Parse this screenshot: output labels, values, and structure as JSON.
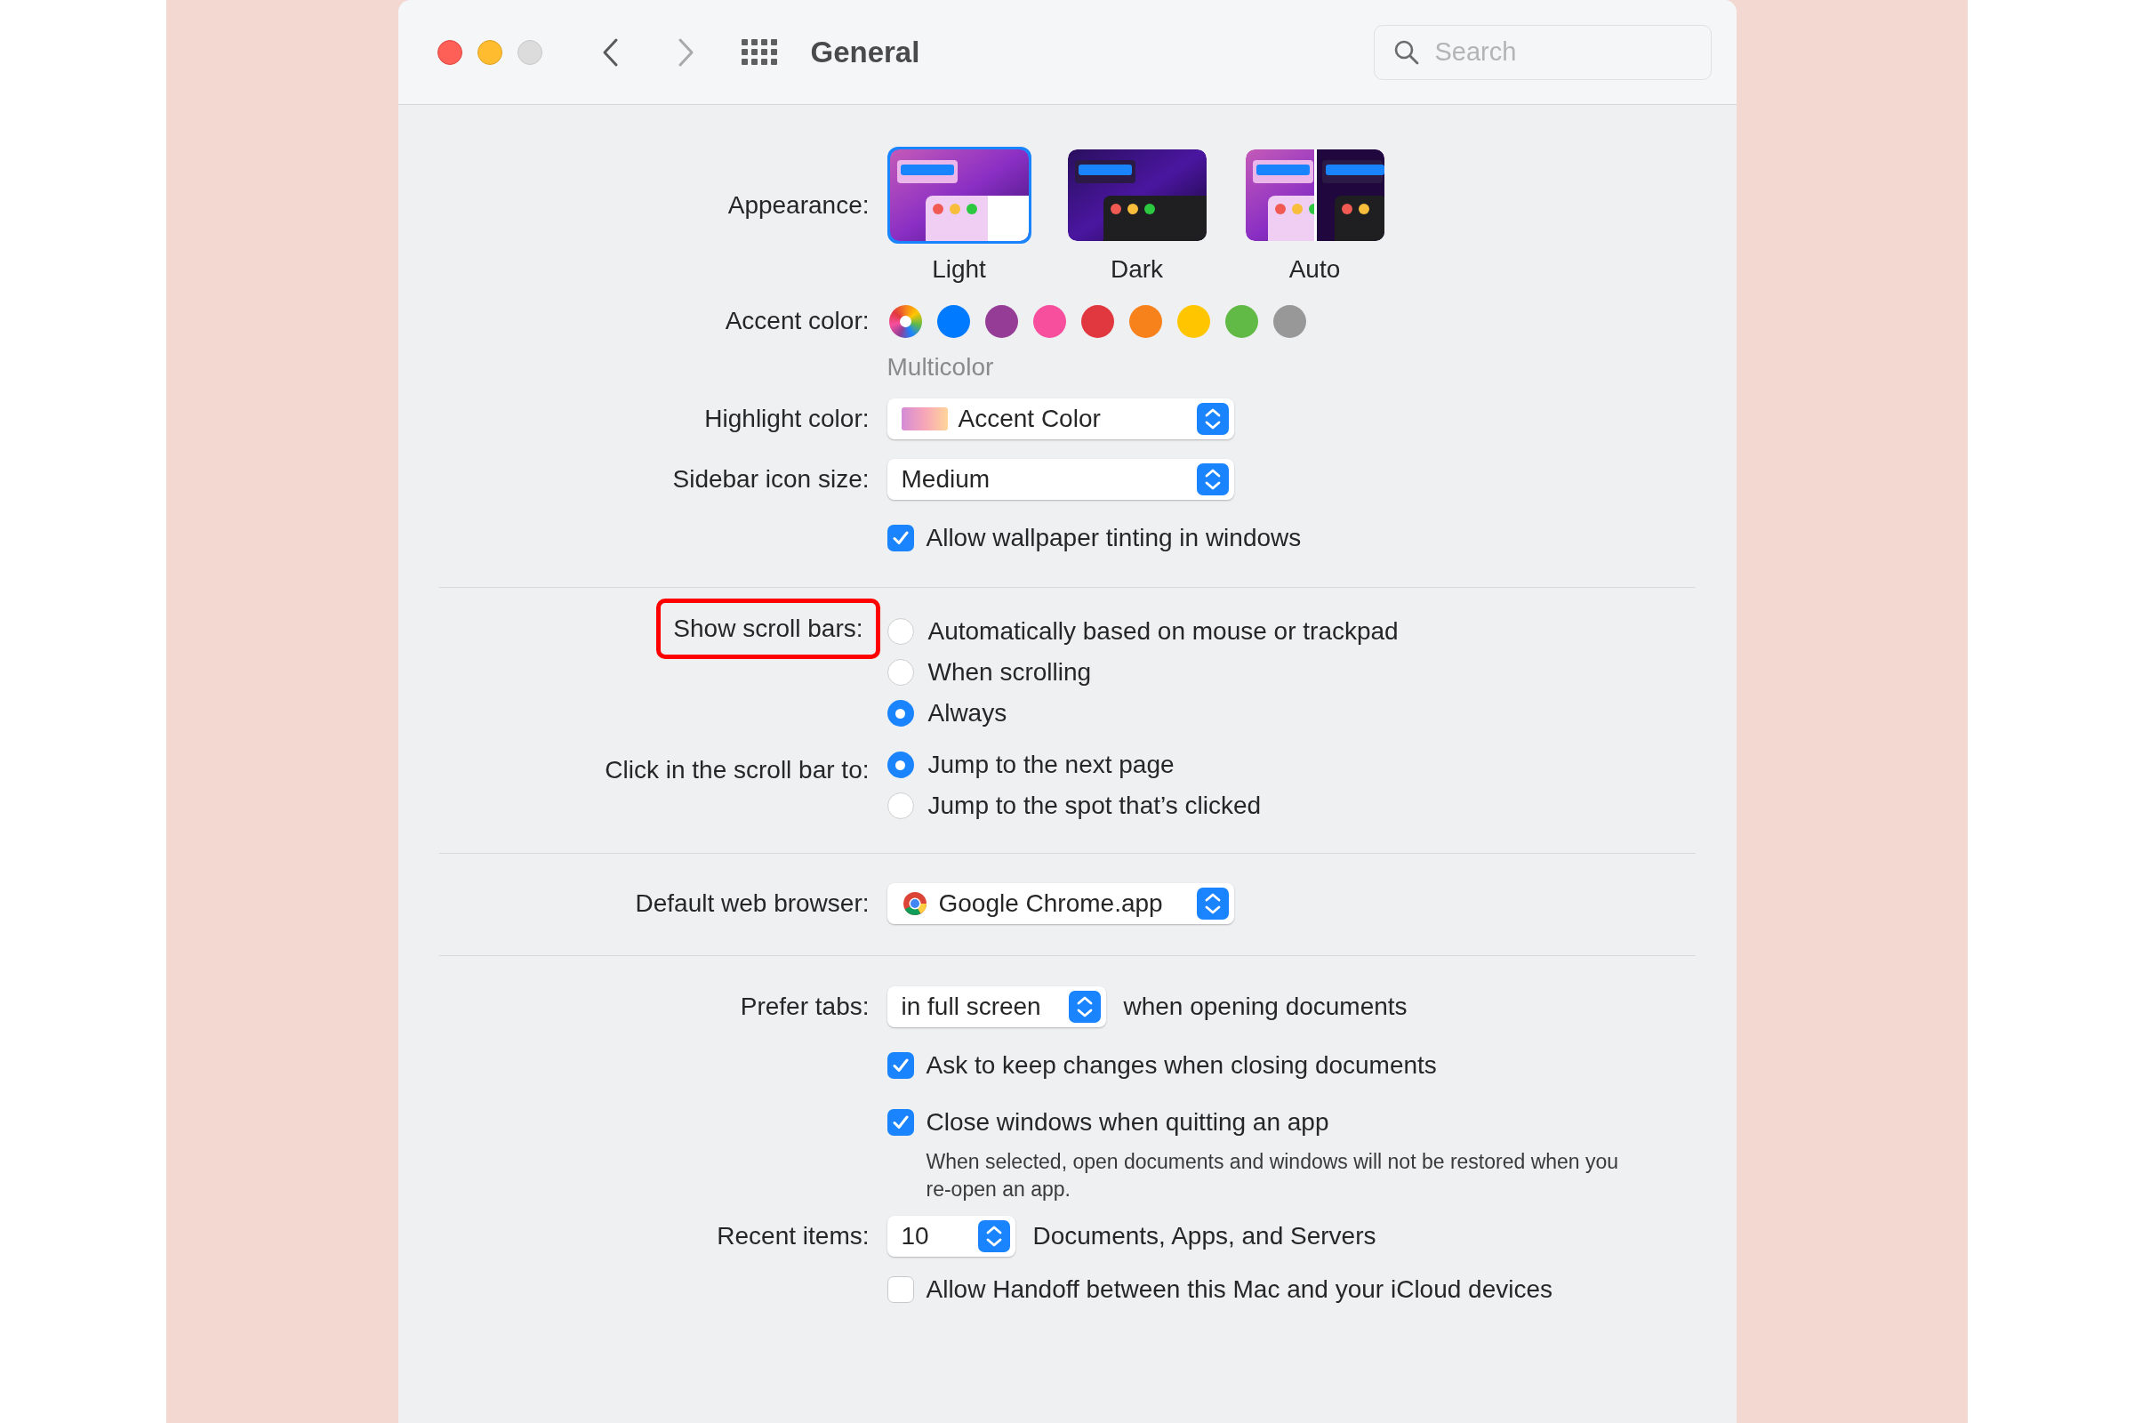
{
  "window": {
    "title": "General",
    "search": {
      "placeholder": "Search"
    },
    "nav": [
      {
        "kind": "back",
        "disabled": false
      },
      {
        "kind": "forward",
        "disabled": true
      }
    ]
  },
  "appearance": {
    "label": "Appearance:",
    "options": [
      {
        "kind": "light",
        "label": "Light",
        "selected": true
      },
      {
        "kind": "dark",
        "label": "Dark",
        "selected": false
      },
      {
        "kind": "auto",
        "label": "Auto",
        "selected": false
      }
    ]
  },
  "accent_color": {
    "label": "Accent color:",
    "caption": "Multicolor",
    "colors": [
      {
        "kind": "multicolor",
        "selected": true
      },
      {
        "kind": "solid",
        "color": "#007aff",
        "selected": false
      },
      {
        "kind": "solid",
        "color": "#953d96",
        "selected": false
      },
      {
        "kind": "solid",
        "color": "#f74f9e",
        "selected": false
      },
      {
        "kind": "solid",
        "color": "#e0383e",
        "selected": false
      },
      {
        "kind": "solid",
        "color": "#f7821b",
        "selected": false
      },
      {
        "kind": "solid",
        "color": "#ffc600",
        "selected": false
      },
      {
        "kind": "solid",
        "color": "#62ba46",
        "selected": false
      },
      {
        "kind": "solid",
        "color": "#989898",
        "selected": false
      }
    ]
  },
  "highlight_color": {
    "label": "Highlight color:",
    "value": "Accent Color"
  },
  "sidebar_icon_size": {
    "label": "Sidebar icon size:",
    "value": "Medium"
  },
  "wallpaper_tinting": {
    "label": "Allow wallpaper tinting in windows",
    "checked": true
  },
  "show_scroll_bars": {
    "label": "Show scroll bars:",
    "annotated": true,
    "options": [
      {
        "label": "Automatically based on mouse or trackpad",
        "selected": false
      },
      {
        "label": "When scrolling",
        "selected": false
      },
      {
        "label": "Always",
        "selected": true
      }
    ]
  },
  "click_scroll_bar": {
    "label": "Click in the scroll bar to:",
    "options": [
      {
        "label": "Jump to the next page",
        "selected": true
      },
      {
        "label": "Jump to the spot that’s clicked",
        "selected": false
      }
    ]
  },
  "default_browser": {
    "label": "Default web browser:",
    "value": "Google Chrome.app"
  },
  "prefer_tabs": {
    "label": "Prefer tabs:",
    "value": "in full screen",
    "suffix": "when opening documents"
  },
  "document_options": [
    {
      "label": "Ask to keep changes when closing documents",
      "checked": true
    },
    {
      "label": "Close windows when quitting an app",
      "checked": true,
      "note": "When selected, open documents and windows will not be restored when you re-open an app."
    }
  ],
  "recent_items": {
    "label": "Recent items:",
    "value": "10",
    "suffix": "Documents, Apps, and Servers"
  },
  "handoff": {
    "label": "Allow Handoff between this Mac and your iCloud devices",
    "checked": false
  }
}
